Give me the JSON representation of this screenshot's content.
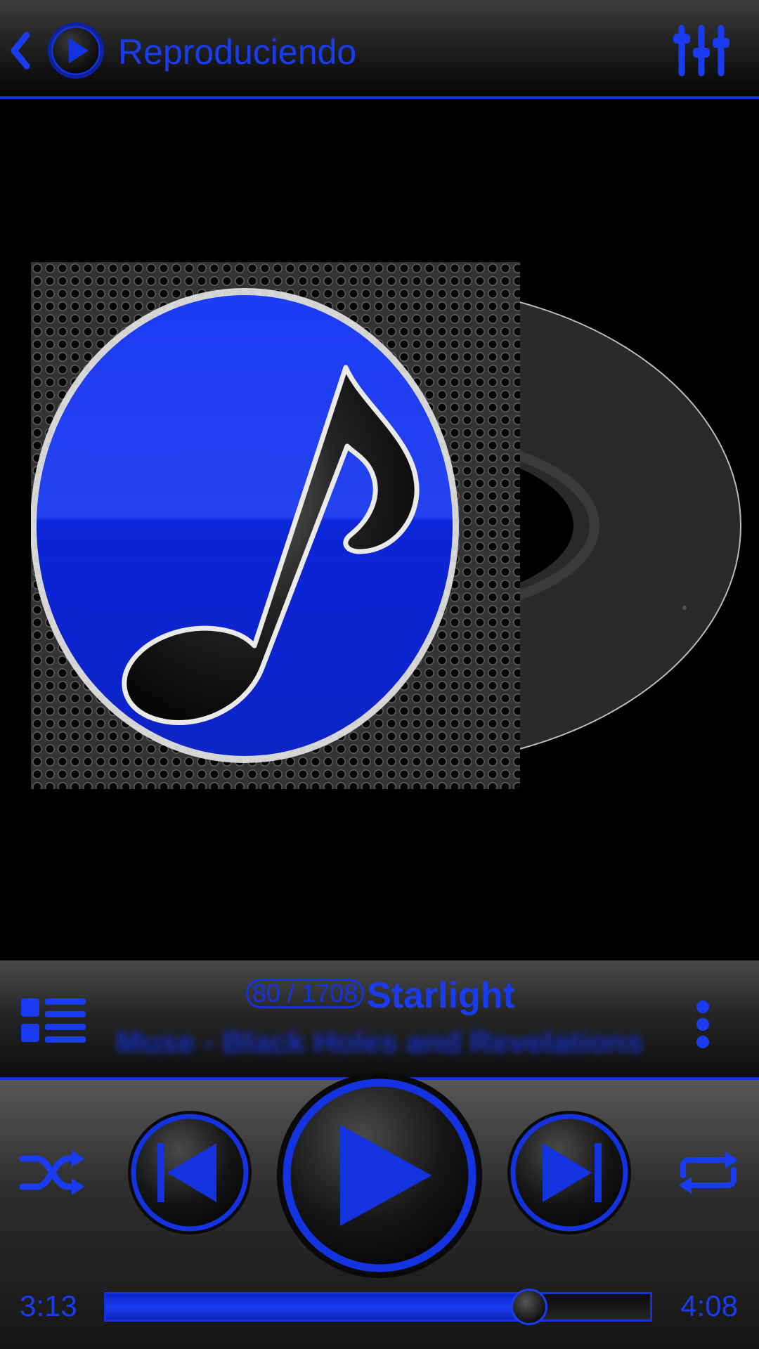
{
  "header": {
    "title": "Reproduciendo",
    "back_icon": "chevron-left-icon",
    "logo_icon": "play-circle-icon",
    "equalizer_icon": "equalizer-sliders-icon"
  },
  "now_playing": {
    "track_position": "80 / 1708",
    "song_title": "Starlight",
    "artist_album": "Muse - Black Holes and Revelations",
    "list_icon": "playlist-icon",
    "more_icon": "more-vertical-icon"
  },
  "controls": {
    "shuffle_icon": "shuffle-icon",
    "previous_icon": "skip-previous-icon",
    "play_icon": "play-icon",
    "next_icon": "skip-next-icon",
    "repeat_icon": "repeat-icon"
  },
  "progress": {
    "elapsed": "3:13",
    "total": "4:08",
    "fraction": 0.7782
  },
  "colors": {
    "accent": "#1a3cf0",
    "background": "#000000"
  }
}
